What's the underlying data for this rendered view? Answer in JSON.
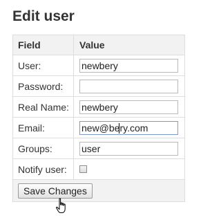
{
  "page": {
    "title": "Edit user"
  },
  "table": {
    "header_field": "Field",
    "header_value": "Value"
  },
  "fields": {
    "user": {
      "label": "User:",
      "value": "newbery"
    },
    "password": {
      "label": "Password:",
      "value": ""
    },
    "real_name": {
      "label": "Real Name:",
      "value": "newbery"
    },
    "email": {
      "label": "Email:",
      "value_before_cursor": "new@be",
      "value_after_cursor": "ry.com"
    },
    "groups": {
      "label": "Groups:",
      "value": "user"
    },
    "notify": {
      "label": "Notify user:",
      "checked": false
    }
  },
  "actions": {
    "save_label": "Save Changes"
  },
  "cursor": {
    "icon": "hand-pointer-icon"
  }
}
